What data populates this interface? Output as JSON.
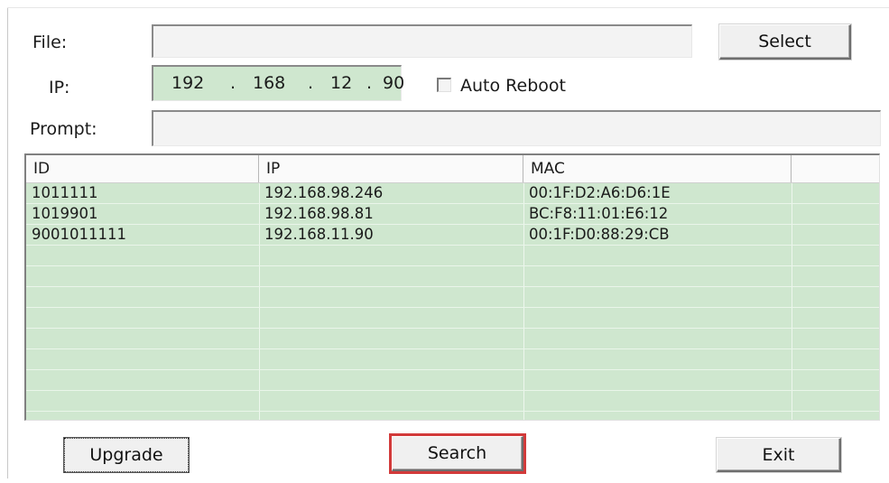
{
  "form": {
    "file_label": "File:",
    "file_value": "",
    "select_label": "Select",
    "ip_label": "IP:",
    "ip_parts": [
      "192",
      "168",
      "12",
      "90"
    ],
    "ip_dot": ".",
    "auto_reboot_label": "Auto Reboot",
    "auto_reboot_checked": false,
    "prompt_label": "Prompt:",
    "prompt_value": ""
  },
  "table": {
    "columns": [
      "ID",
      "IP",
      "MAC",
      ""
    ],
    "rows": [
      {
        "id": "1011111",
        "ip": "192.168.98.246",
        "mac": "00:1F:D2:A6:D6:1E"
      },
      {
        "id": "1019901",
        "ip": "192.168.98.81",
        "mac": "BC:F8:11:01:E6:12"
      },
      {
        "id": "9001011111",
        "ip": "192.168.11.90",
        "mac": "00:1F:D0:88:29:CB"
      }
    ],
    "row_color": "#cfe7cf"
  },
  "buttons": {
    "upgrade": "Upgrade",
    "search": "Search",
    "exit": "Exit",
    "highlight_color": "#d23a3a"
  }
}
